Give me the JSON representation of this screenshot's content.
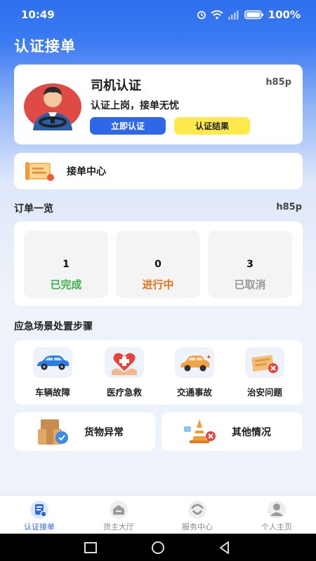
{
  "status_bar": {
    "time": "10:49",
    "battery": "100%"
  },
  "page": {
    "title": "认证接单"
  },
  "driver_card": {
    "title": "司机认证",
    "code": "h85p",
    "subtitle": "认证上岗，接单无忧",
    "apply_label": "立即认证",
    "result_label": "认证结果"
  },
  "order_center": {
    "label": "接单中心"
  },
  "orders_overview": {
    "title": "订单一览",
    "code": "h85p",
    "items": [
      {
        "count": "1",
        "label": "已完成"
      },
      {
        "count": "0",
        "label": "进行中"
      },
      {
        "count": "3",
        "label": "已取消"
      }
    ],
    "colors": {
      "done": "#3bb34a",
      "progress": "#e8721f",
      "cancel": "#999999"
    }
  },
  "emergency": {
    "title": "应急场景处置步骤",
    "items": [
      {
        "label": "车辆故障",
        "icon": "car-icon"
      },
      {
        "label": "医疗急救",
        "icon": "medical-icon"
      },
      {
        "label": "交通事故",
        "icon": "accident-icon"
      },
      {
        "label": "治安问题",
        "icon": "security-icon"
      }
    ],
    "extra": [
      {
        "label": "货物异常",
        "icon": "cargo-icon"
      },
      {
        "label": "其他情况",
        "icon": "other-icon"
      }
    ]
  },
  "tabbar": {
    "items": [
      {
        "label": "认证接单",
        "icon": "order-icon",
        "active": true
      },
      {
        "label": "货主大厅",
        "icon": "hall-icon",
        "active": false
      },
      {
        "label": "服务中心",
        "icon": "service-icon",
        "active": false
      },
      {
        "label": "个人主页",
        "icon": "profile-icon",
        "active": false
      }
    ]
  },
  "theme": {
    "accent": "#2f67e9",
    "highlight": "#ffe94d"
  }
}
